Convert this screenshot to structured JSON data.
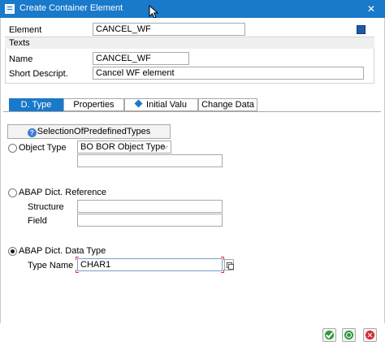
{
  "window": {
    "title": "Create Container Element",
    "close_glyph": "✕"
  },
  "header": {
    "element_label": "Element",
    "element_value": "CANCEL_WF"
  },
  "texts": {
    "group_title": "Texts",
    "name_label": "Name",
    "name_value": "CANCEL_WF",
    "short_descr_label": "Short Descript.",
    "short_descr_value": "Cancel WF element"
  },
  "tabs": [
    {
      "label": "D. Type",
      "active": true
    },
    {
      "label": "Properties",
      "active": false
    },
    {
      "label": "Initial Valu",
      "active": false,
      "icon": "diamond-icon"
    },
    {
      "label": "Change Data",
      "active": false
    }
  ],
  "dtype": {
    "selection_button": "SelectionOfPredefinedTypes",
    "object_type_label": "Object Type",
    "object_type_selected": "BO BOR Object Type",
    "object_type_value": "",
    "abap_ref_label": "ABAP Dict. Reference",
    "structure_label": "Structure",
    "structure_value": "",
    "field_label": "Field",
    "field_value": "",
    "abap_type_label": "ABAP Dict. Data Type",
    "type_name_label": "Type Name",
    "type_name_value": "CHAR1",
    "selected_radio": "abap_type"
  },
  "colors": {
    "titlebar": "#1979ca",
    "accent": "#1979ca",
    "ok": "#2c9a3c",
    "cancel": "#d8262e"
  }
}
